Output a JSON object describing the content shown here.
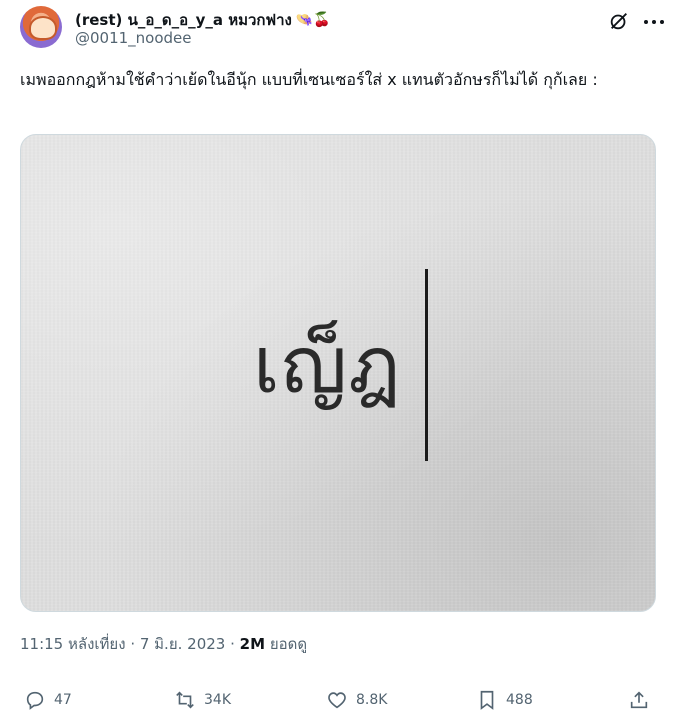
{
  "author": {
    "display_name": "(rest) น_อ_ด_อ_y_a หมวกฟาง",
    "emojis": "👒🍒",
    "handle": "@0011_noodee"
  },
  "tweet": {
    "text": "เมพออกกฎห้ามใช้คำว่าเย้ดในอีนุ้ก แบบที่เซนเซอร์ใส่ x แทนตัวอักษรก็ไม่ได้ กุก้เลย :"
  },
  "media": {
    "photo_text": "เญ็ฎ"
  },
  "meta": {
    "time": "11:15 หลังเที่ยง",
    "date": "7 มิ.ย. 2023",
    "views_count": "2M",
    "views_label": "ยอดดู"
  },
  "actions": {
    "replies": "47",
    "reposts": "34K",
    "likes": "8.8K",
    "bookmarks": "488"
  },
  "colors": {
    "text": "#0f1419",
    "secondary": "#536471",
    "border": "#cfd9de"
  }
}
